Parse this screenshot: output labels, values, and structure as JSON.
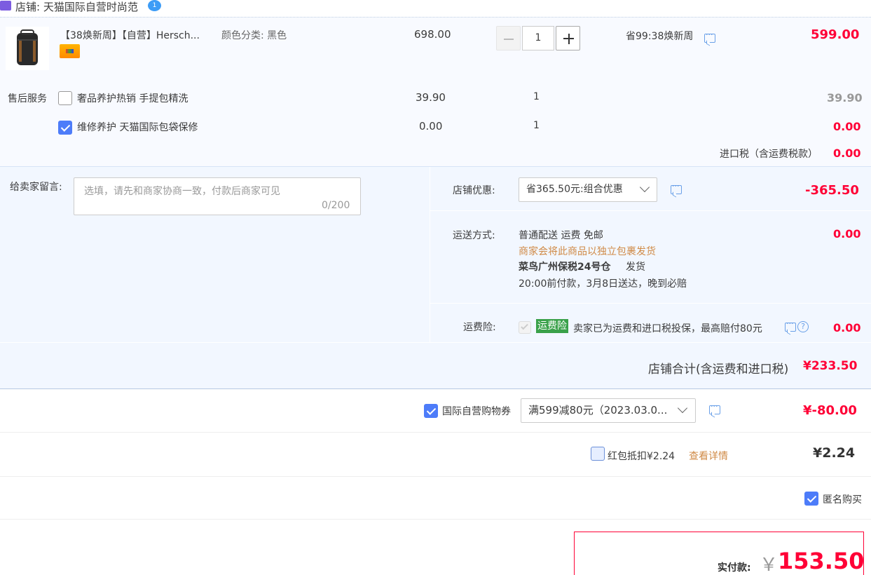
{
  "shop": {
    "label": "店铺: 天猫国际自营时尚范",
    "badge": "1"
  },
  "product": {
    "title": "【38焕新周】【自营】Hersch...",
    "sku": "颜色分类: 黑色",
    "unit_price": "698.00",
    "quantity": "1",
    "promo": "省99:38焕新周",
    "subtotal": "599.00"
  },
  "after_sale": {
    "label": "售后服务",
    "items": [
      {
        "name": "奢品养护热销 手提包精洗",
        "price": "39.90",
        "qty": "1",
        "total": "39.90",
        "checked": false
      },
      {
        "name": "维修养护 天猫国际包袋保修",
        "price": "0.00",
        "qty": "1",
        "total": "0.00",
        "checked": true
      }
    ]
  },
  "import_tax": {
    "label": "进口税（含运费税款）",
    "value": "0.00"
  },
  "message": {
    "label": "给卖家留言:",
    "placeholder": "选填，请先和商家协商一致，付款后商家可见",
    "counter": "0/200"
  },
  "shop_discount": {
    "label": "店铺优惠:",
    "selected": "省365.50元:组合优惠",
    "value": "-365.50"
  },
  "shipping": {
    "label": "运送方式:",
    "line1": "普通配送 运费 免邮",
    "line2": "商家会将此商品以独立包裹发货",
    "warehouse": "菜鸟广州保税24号仓",
    "ship_word": "发货",
    "line4": "20:00前付款，3月8日送达，晚到必赔",
    "value": "0.00"
  },
  "insurance": {
    "label": "运费险:",
    "tag": "运费险",
    "desc": "卖家已为运费和进口税投保，最高赔付80元",
    "value": "0.00"
  },
  "shop_total": {
    "label": "店铺合计(含运费和进口税)",
    "value": "¥233.50"
  },
  "coupon": {
    "label": "国际自营购物券",
    "selected": "满599减80元（2023.03.0...",
    "value": "¥-80.00",
    "checked": true
  },
  "redpacket": {
    "label": "红包抵扣¥2.24",
    "link": "查看详情",
    "value": "¥2.24",
    "checked": false
  },
  "anonymous": {
    "label": "匿名购买",
    "checked": true
  },
  "pay": {
    "label": "实付款:",
    "currency": "￥",
    "value": "153.50"
  },
  "colors": {
    "accent": "#ff0036",
    "checkbox": "#4d7cf9",
    "panel_bg": "#f2f7ff"
  }
}
